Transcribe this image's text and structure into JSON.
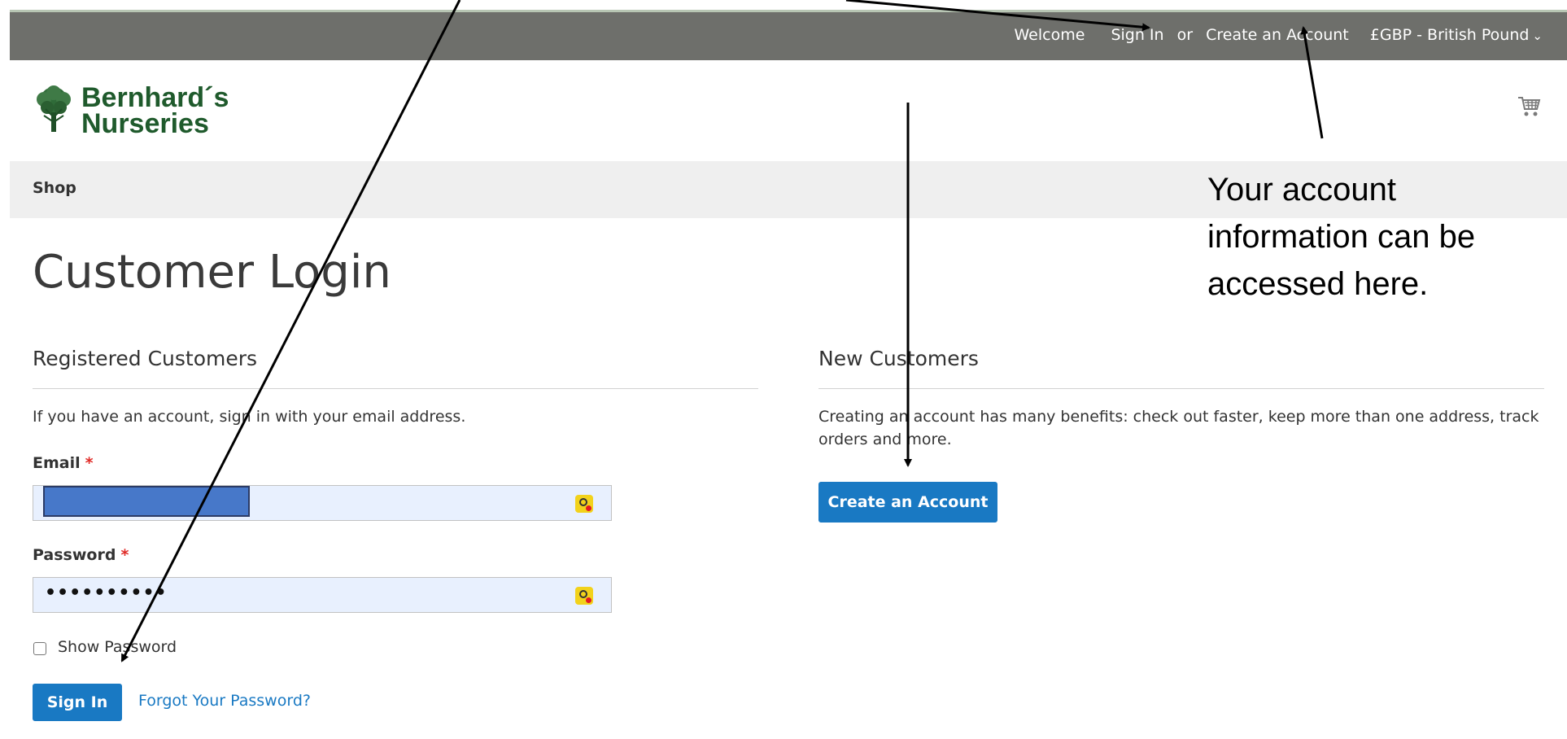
{
  "header": {
    "welcome": "Welcome",
    "sign_in": "Sign In",
    "or": "or",
    "create_account": "Create an Account",
    "currency": "£GBP - British Pound"
  },
  "logo": {
    "line1": "Bernhard´s",
    "line2": "Nurseries"
  },
  "nav": {
    "shop": "Shop"
  },
  "page": {
    "title": "Customer Login"
  },
  "registered": {
    "title": "Registered Customers",
    "note": "If you have an account, sign in with your email address.",
    "email_label": "Email",
    "password_label": "Password",
    "required_mark": "*",
    "password_value": "••••••••••",
    "show_password": "Show Password",
    "sign_in_button": "Sign In",
    "forgot_link": "Forgot Your Password?"
  },
  "new_customers": {
    "title": "New Customers",
    "note": "Creating an account has many benefits: check out faster, keep more than one address, track orders and more.",
    "create_button": "Create an Account"
  },
  "annotation": {
    "text": "Your account information can be accessed here."
  },
  "colors": {
    "topbar": "#6e6f6b",
    "primary": "#1979c3",
    "nav_bg": "#efefef",
    "input_bg": "#e8f0fe",
    "required": "#e02b27",
    "logo_green": "#1f5a2c"
  }
}
